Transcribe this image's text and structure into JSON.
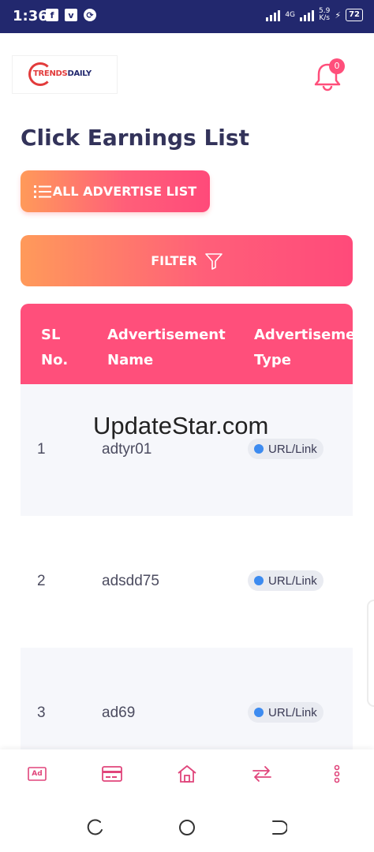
{
  "status_bar": {
    "time": "1:36",
    "network": "4G",
    "speed_value": "5.9",
    "speed_unit": "K/s",
    "battery": "72"
  },
  "header": {
    "logo_part1": "TRENDS",
    "logo_part2": "DAILY",
    "notification_count": "0"
  },
  "page": {
    "title": "Click Earnings List",
    "all_button_label": "ALL ADVERTISE LIST",
    "filter_button_label": "FILTER"
  },
  "table": {
    "headers": {
      "sl": [
        "SL",
        "No."
      ],
      "name": [
        "Advertisement",
        "Name"
      ],
      "type": [
        "Advertisemen",
        "Type"
      ]
    },
    "rows": [
      {
        "sl": "1",
        "name": "adtyr01",
        "type": "URL/Link"
      },
      {
        "sl": "2",
        "name": "adsdd75",
        "type": "URL/Link"
      },
      {
        "sl": "3",
        "name": "ad69",
        "type": "URL/Link"
      }
    ]
  },
  "watermark": "UpdateStar.com",
  "bottom_nav": {
    "ad_icon_label": "Ad"
  },
  "colors": {
    "status_bar": "#22286e",
    "accent": "#ff4f7b",
    "gradient_start": "#ff9a5a",
    "chip_dot": "#3d8bf0"
  }
}
